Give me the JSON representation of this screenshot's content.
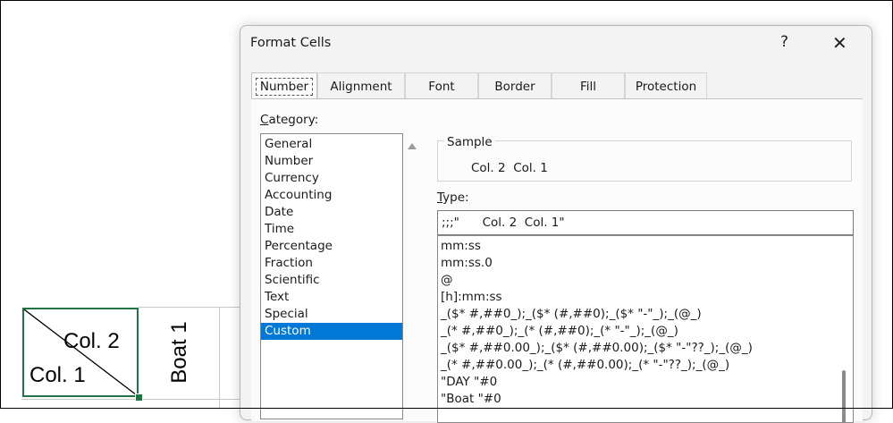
{
  "spreadsheet": {
    "cell_top_right": "Col. 2",
    "cell_bottom_left": "Col. 1",
    "vertical_cell": "Boat 1",
    "selection_color": "#217346"
  },
  "dialog": {
    "title": "Format Cells",
    "help_label": "?",
    "close_label": "✕",
    "tabs": [
      "Number",
      "Alignment",
      "Font",
      "Border",
      "Fill",
      "Protection"
    ],
    "category_label_key": "C",
    "category_label_rest": "ategory:",
    "categories": [
      "General",
      "Number",
      "Currency",
      "Accounting",
      "Date",
      "Time",
      "Percentage",
      "Fraction",
      "Scientific",
      "Text",
      "Special",
      "Custom"
    ],
    "selected_category": "Custom",
    "selection_color": "#0078d7",
    "sample_label": "Sample",
    "sample_value": "Col. 2  Col. 1",
    "type_label_key": "T",
    "type_label_rest": "ype:",
    "type_value": ";;;\"      Col. 2  Col. 1\"",
    "type_list": [
      "mm:ss",
      "mm:ss.0",
      "@",
      "[h]:mm:ss",
      "_($* #,##0_);_($* (#,##0);_($* \"-\"_);_(@_)",
      "_(* #,##0_);_(* (#,##0);_(* \"-\"_);_(@_)",
      "_($* #,##0.00_);_($* (#,##0.00);_($* \"-\"??_);_(@_)",
      "_(* #,##0.00_);_(* (#,##0.00);_(* \"-\"??_);_(@_)",
      "\"DAY \"#0",
      "\"Boat \"#0"
    ]
  }
}
